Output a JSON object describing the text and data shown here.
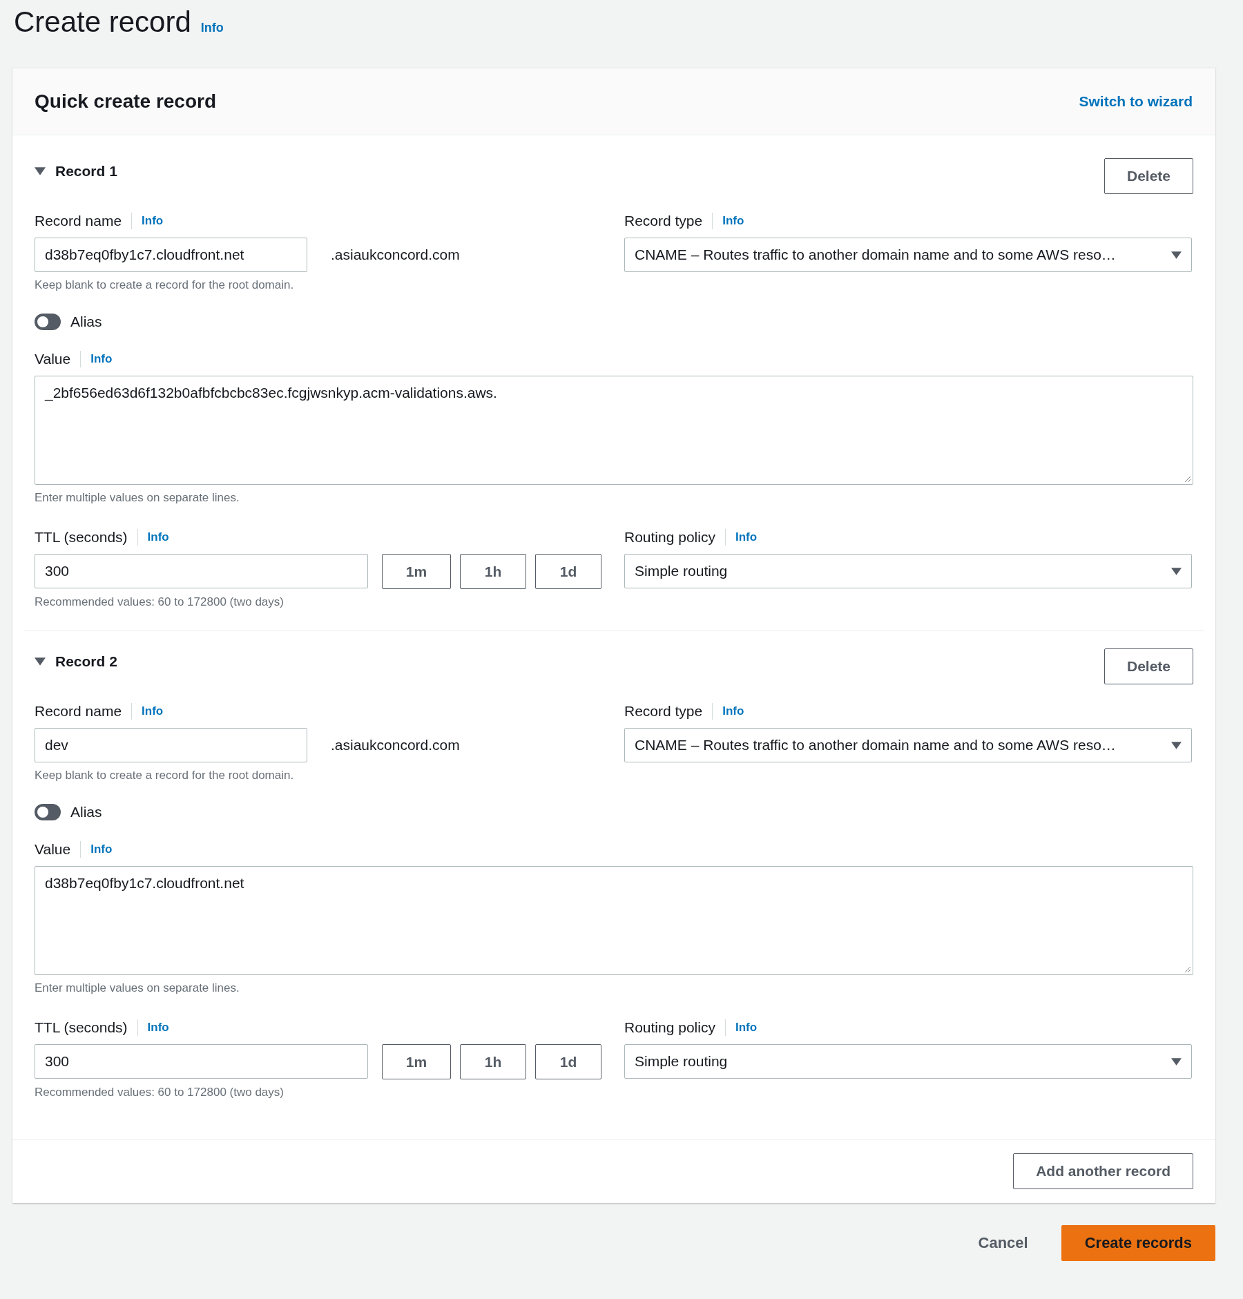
{
  "page": {
    "title": "Create record",
    "info": "Info"
  },
  "panel": {
    "title": "Quick create record",
    "switch_link": "Switch to wizard"
  },
  "records": [
    {
      "heading": "Record 1",
      "expanded": true,
      "delete": "Delete",
      "name_field": {
        "label": "Record name",
        "info": "Info",
        "value": "d38b7eq0fby1c7.cloudfront.net",
        "suffix": ".asiaukconcord.com",
        "hint": "Keep blank to create a record for the root domain."
      },
      "type_field": {
        "label": "Record type",
        "info": "Info",
        "value": "CNAME – Routes traffic to another domain name and to some AWS reso…"
      },
      "alias": {
        "label": "Alias",
        "on": false
      },
      "value_field": {
        "label": "Value",
        "info": "Info",
        "value": "_2bf656ed63d6f132b0afbfcbcbc83ec.fcgjwsnkyp.acm-validations.aws.",
        "hint": "Enter multiple values on separate lines."
      },
      "ttl": {
        "label": "TTL (seconds)",
        "info": "Info",
        "value": "300",
        "presets": [
          "1m",
          "1h",
          "1d"
        ],
        "hint": "Recommended values: 60 to 172800 (two days)"
      },
      "routing": {
        "label": "Routing policy",
        "info": "Info",
        "value": "Simple routing"
      }
    },
    {
      "heading": "Record 2",
      "expanded": true,
      "delete": "Delete",
      "name_field": {
        "label": "Record name",
        "info": "Info",
        "value": "dev",
        "suffix": ".asiaukconcord.com",
        "hint": "Keep blank to create a record for the root domain."
      },
      "type_field": {
        "label": "Record type",
        "info": "Info",
        "value": "CNAME – Routes traffic to another domain name and to some AWS reso…"
      },
      "alias": {
        "label": "Alias",
        "on": false
      },
      "value_field": {
        "label": "Value",
        "info": "Info",
        "value": "d38b7eq0fby1c7.cloudfront.net",
        "hint": "Enter multiple values on separate lines."
      },
      "ttl": {
        "label": "TTL (seconds)",
        "info": "Info",
        "value": "300",
        "presets": [
          "1m",
          "1h",
          "1d"
        ],
        "hint": "Recommended values: 60 to 172800 (two days)"
      },
      "routing": {
        "label": "Routing policy",
        "info": "Info",
        "value": "Simple routing"
      }
    }
  ],
  "add_button": "Add another record",
  "actions": {
    "cancel": "Cancel",
    "submit": "Create records"
  }
}
